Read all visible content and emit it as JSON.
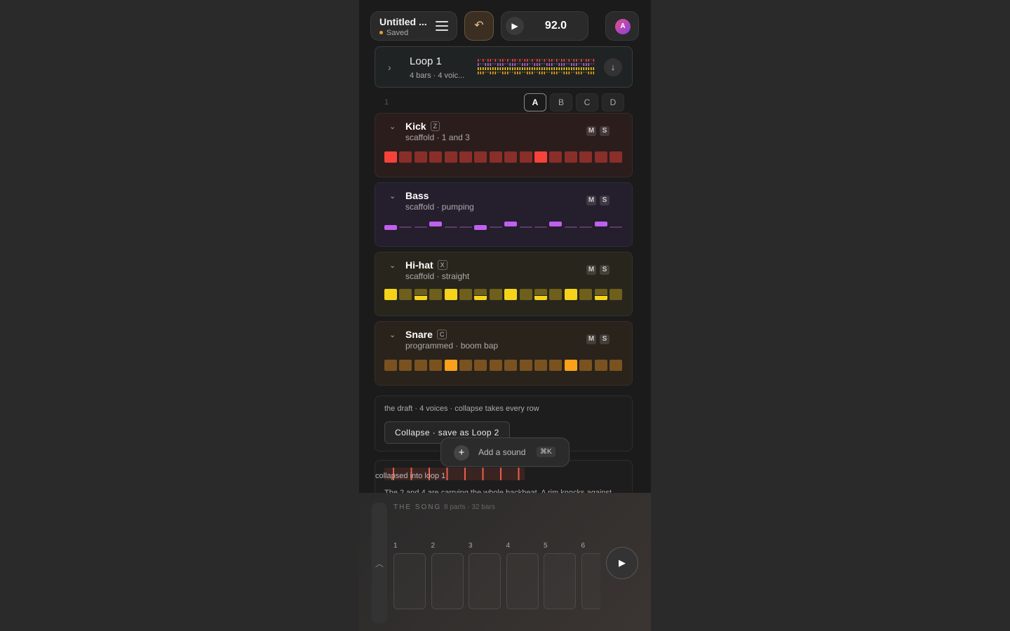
{
  "header": {
    "title": "Untitled ...",
    "status": "Saved",
    "undo_icon": "undo-icon",
    "play_icon": "play-icon",
    "bpm": "92.0",
    "avatar_letter": "A"
  },
  "loop": {
    "name": "Loop 1",
    "meta": "4 bars · 4 voic...",
    "download_icon": "arrow-down-icon"
  },
  "bar": {
    "number": "1",
    "variants": [
      "A",
      "B",
      "C",
      "D"
    ],
    "active_variant": "A"
  },
  "tracks": [
    {
      "name": "Kick",
      "hotkey": "Z",
      "subtitle": "scaffold · 1 and 3",
      "mute": "M",
      "solo": "S",
      "style": "steps",
      "color": "#f5433a",
      "dim": "#8a2e2a",
      "bg": "#2c1d1d",
      "steps": [
        1,
        0,
        0,
        0,
        0,
        0,
        0,
        0,
        0,
        0,
        1,
        0,
        0,
        0,
        0,
        0
      ]
    },
    {
      "name": "Bass",
      "hotkey": "",
      "subtitle": "scaffold · pumping",
      "mute": "M",
      "solo": "S",
      "style": "notes",
      "color": "#c060f0",
      "dim": "#5a3a6a",
      "bg": "#251e2c",
      "notes": [
        1,
        0,
        0,
        2,
        0,
        0,
        1,
        0,
        2,
        0,
        0,
        2,
        0,
        0,
        2,
        0
      ]
    },
    {
      "name": "Hi-hat",
      "hotkey": "X",
      "subtitle": "scaffold · straight",
      "mute": "M",
      "solo": "S",
      "style": "hats",
      "color": "#f5d31a",
      "dim": "#6e5f1c",
      "bg": "#28261c",
      "hats": [
        2,
        0,
        1,
        0,
        2,
        0,
        1,
        0,
        2,
        0,
        1,
        0,
        2,
        0,
        1,
        0
      ]
    },
    {
      "name": "Snare",
      "hotkey": "C",
      "subtitle": "programmed · boom bap",
      "mute": "M",
      "solo": "S",
      "style": "steps",
      "color": "#f9a11a",
      "dim": "#7a5220",
      "bg": "#2a231c",
      "steps": [
        0,
        0,
        0,
        0,
        1,
        0,
        0,
        0,
        0,
        0,
        0,
        0,
        1,
        0,
        0,
        0
      ]
    }
  ],
  "draft": {
    "text": "the draft · 4 voices · collapse takes every row",
    "button": "Collapse · save as Loop 2"
  },
  "add_sound": {
    "label": "Add a sound",
    "shortcut": "⌘K"
  },
  "collapsed": {
    "label": "collapsed into loop 1",
    "description": "The 2 and 4 are carrying the whole backbeat. A rim knocks against"
  },
  "song": {
    "title": "THE SONG",
    "meta": "8 parts · 32 bars",
    "parts": [
      "1",
      "2",
      "3",
      "4",
      "5",
      "6"
    ]
  },
  "colors": {
    "accent": "#e0a030",
    "background": "#1b1b1b"
  }
}
